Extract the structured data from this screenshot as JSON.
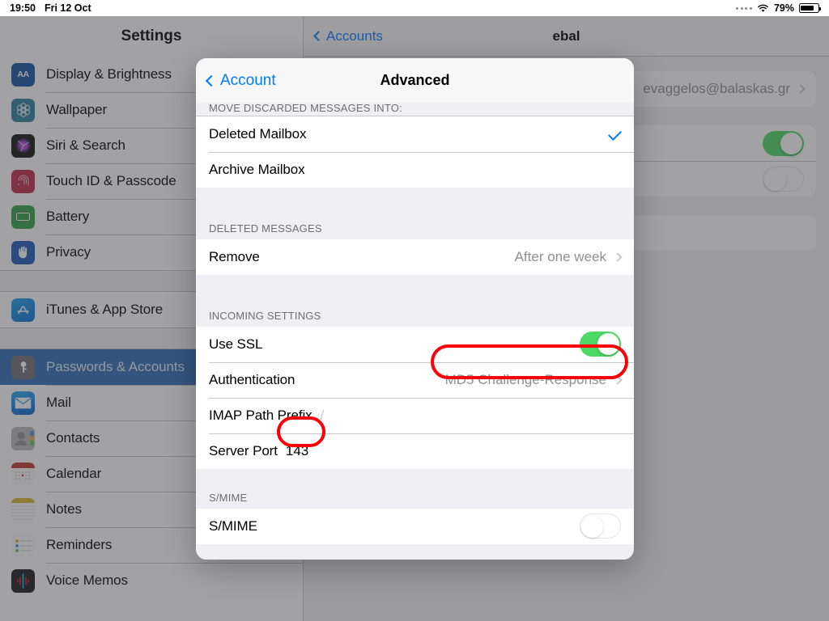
{
  "statusbar": {
    "time": "19:50",
    "date": "Fri 12 Oct",
    "battery_percent": "79%",
    "wifi_icon": "wifi-icon",
    "battery_icon": "battery-icon",
    "activity_dots_icon": "signal-dots-icon"
  },
  "sidebar": {
    "title": "Settings",
    "items": [
      {
        "label": "Display & Brightness",
        "icon": "display-brightness-icon",
        "selected": false
      },
      {
        "label": "Wallpaper",
        "icon": "wallpaper-icon",
        "selected": false
      },
      {
        "label": "Siri & Search",
        "icon": "siri-search-icon",
        "selected": false
      },
      {
        "label": "Touch ID & Passcode",
        "icon": "touch-id-icon",
        "selected": false
      },
      {
        "label": "Battery",
        "icon": "battery-settings-icon",
        "selected": false
      },
      {
        "label": "Privacy",
        "icon": "privacy-hand-icon",
        "selected": false
      }
    ],
    "items2": [
      {
        "label": "iTunes & App Store",
        "icon": "app-store-icon",
        "selected": false
      }
    ],
    "items3": [
      {
        "label": "Passwords & Accounts",
        "icon": "passwords-key-icon",
        "selected": true
      },
      {
        "label": "Mail",
        "icon": "mail-icon",
        "selected": false
      },
      {
        "label": "Contacts",
        "icon": "contacts-icon",
        "selected": false
      },
      {
        "label": "Calendar",
        "icon": "calendar-icon",
        "selected": false
      },
      {
        "label": "Notes",
        "icon": "notes-icon",
        "selected": false
      },
      {
        "label": "Reminders",
        "icon": "reminders-icon",
        "selected": false
      },
      {
        "label": "Voice Memos",
        "icon": "voice-memos-icon",
        "selected": false
      }
    ]
  },
  "detail": {
    "back_label": "Accounts",
    "title": "ebal",
    "account_row_value": "evaggelos@balaskas.gr",
    "toggle1_state": "on",
    "toggle2_state": "off"
  },
  "modal": {
    "back_label": "Account",
    "title": "Advanced",
    "section_move": {
      "header": "MOVE DISCARDED MESSAGES INTO:",
      "rows": [
        {
          "label": "Deleted Mailbox",
          "checked": true
        },
        {
          "label": "Archive Mailbox",
          "checked": false
        }
      ]
    },
    "section_deleted": {
      "header": "DELETED MESSAGES",
      "rows": [
        {
          "label": "Remove",
          "value": "After one week",
          "chevron": true
        }
      ]
    },
    "section_incoming": {
      "header": "INCOMING SETTINGS",
      "ssl_label": "Use SSL",
      "ssl_state": "on",
      "auth_label": "Authentication",
      "auth_value": "MD5 Challenge-Response",
      "imap_label": "IMAP Path Prefix",
      "imap_value": "/",
      "port_label": "Server Port",
      "port_value": "143"
    },
    "section_smime": {
      "header": "S/MIME",
      "label": "S/MIME",
      "state": "off"
    }
  },
  "annotations": {
    "color": "#fb0007",
    "highlight_auth": "MD5 Challenge-Response",
    "highlight_port": "143"
  }
}
